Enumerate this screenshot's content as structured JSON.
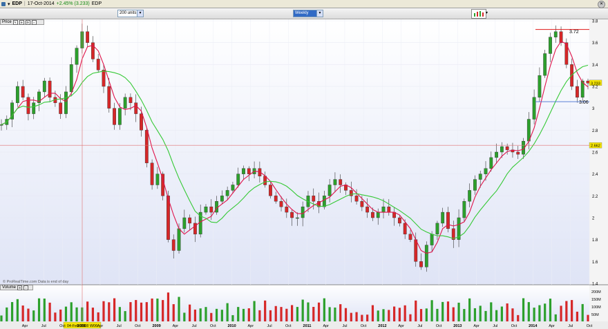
{
  "window": {
    "instrument": "EDP",
    "date": "17-Oct-2014",
    "change": "+2.45% (3.233)",
    "code": "EDP"
  },
  "toolbar": {
    "units_value": "200 units",
    "period_value": "Weekly"
  },
  "price_panel": {
    "label": "Price",
    "watermark": "© ProRealTime.com  Data is end of day",
    "last_price_tag": "3.233",
    "crosshair_price_tag": "2.662",
    "crosshair_date_tag": "04-Feb-2008 W06",
    "annotation_high": "3.72",
    "annotation_low": "3.06"
  },
  "volume_panel": {
    "label": "Volume",
    "scale_labels": [
      "200M",
      "150M",
      "100M",
      "50M"
    ]
  },
  "colors": {
    "up": "#2ca02c",
    "down": "#d62728",
    "ma_fast": "#e0134a",
    "ma_slow": "#36c936",
    "line_high": "#e01818",
    "line_low": "#5a7fd6",
    "crosshair": "#e07070"
  },
  "chart_data": {
    "type": "line",
    "title": "",
    "ylim": [
      1.4,
      3.8
    ],
    "y_ticks": [
      1.4,
      1.6,
      1.8,
      2,
      2.2,
      2.4,
      2.6,
      2.8,
      3,
      3.2,
      3.4,
      3.6,
      3.8
    ],
    "x_tick_labels": [
      "Apr",
      "Jul",
      "Oct",
      "2008",
      "Apr",
      "Jul",
      "Oct",
      "2009",
      "Apr",
      "Jul",
      "Oct",
      "2010",
      "Apr",
      "Jul",
      "Oct",
      "2011",
      "Apr",
      "Jul",
      "Oct",
      "2012",
      "Apr",
      "Jul",
      "Oct",
      "2013",
      "Apr",
      "Jul",
      "Oct",
      "2014",
      "Apr",
      "Jul",
      "Oct"
    ],
    "x_year_labels": [
      "2008",
      "2009",
      "2010",
      "2011",
      "2012",
      "2013",
      "2014"
    ],
    "series": [
      {
        "values": [
          2.85,
          2.9,
          3.05,
          3.2,
          3.1,
          2.95,
          3.05,
          3.15,
          3.25,
          3.1,
          3.05,
          2.95,
          3.15,
          3.4,
          3.55,
          3.7,
          3.6,
          3.45,
          3.35,
          3.2,
          3.0,
          2.85,
          3.0,
          3.1,
          3.05,
          2.95,
          2.8,
          2.5,
          2.3,
          2.4,
          2.2,
          1.8,
          1.7,
          1.9,
          2.0,
          1.95,
          1.85,
          2.05,
          2.1,
          2.05,
          2.15,
          2.2,
          2.25,
          2.3,
          2.4,
          2.45,
          2.4,
          2.45,
          2.38,
          2.3,
          2.2,
          2.15,
          2.1,
          2.05,
          2.0,
          2.0,
          2.1,
          2.2,
          2.15,
          2.1,
          2.2,
          2.3,
          2.35,
          2.3,
          2.25,
          2.2,
          2.15,
          2.1,
          2.05,
          2.0,
          2.05,
          2.1,
          2.05,
          2.0,
          1.95,
          1.85,
          1.8,
          1.6,
          1.55,
          1.75,
          1.85,
          1.95,
          2.05,
          1.9,
          1.8,
          2.0,
          2.15,
          2.25,
          2.35,
          2.4,
          2.45,
          2.55,
          2.6,
          2.65,
          2.62,
          2.6,
          2.58,
          2.7,
          2.9,
          3.1,
          3.3,
          3.5,
          3.65,
          3.7,
          3.6,
          3.4,
          3.2,
          3.1,
          3.25,
          3.23
        ]
      }
    ]
  }
}
